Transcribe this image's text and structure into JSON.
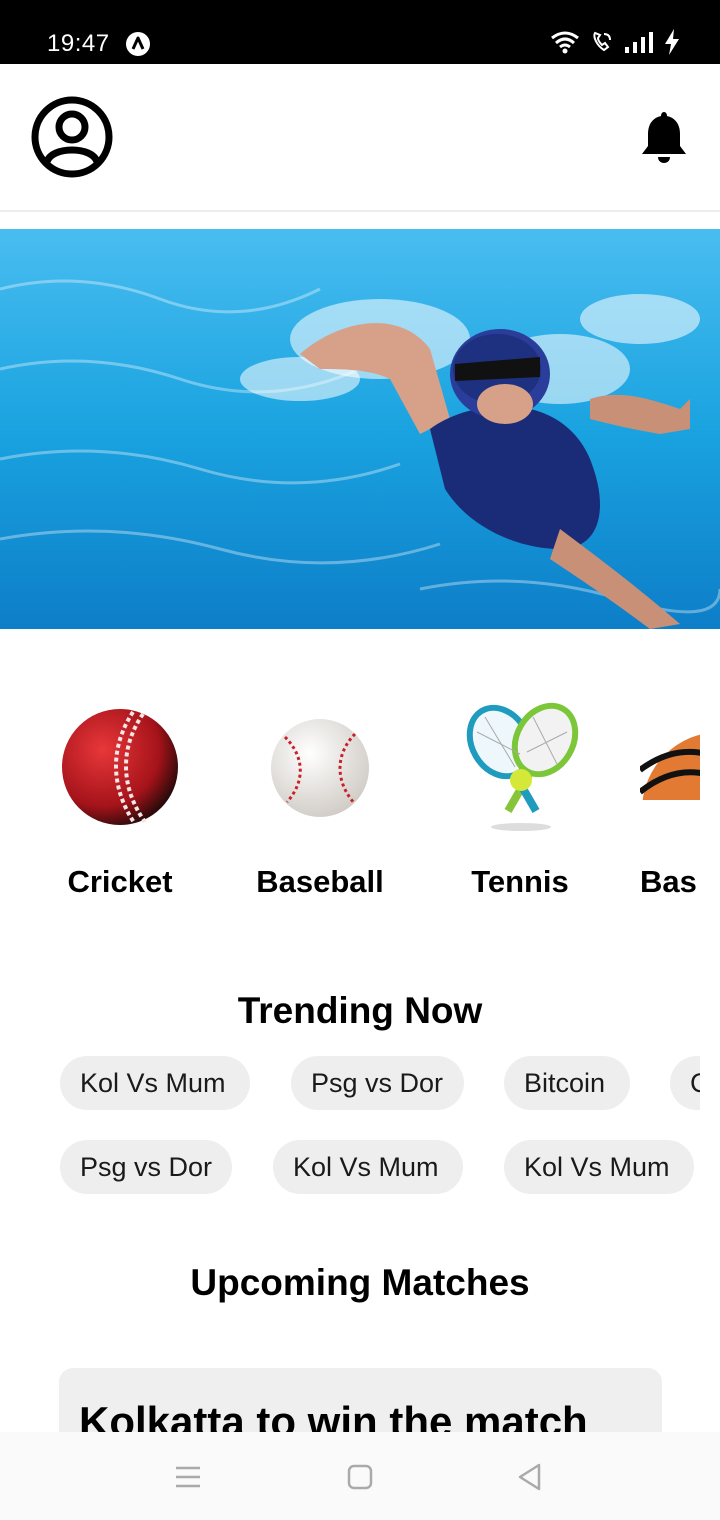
{
  "status_bar": {
    "time": "19:47",
    "app_icon": "a-circle-icon",
    "icons": [
      "wifi-icon",
      "wifi-call-icon",
      "signal-icon",
      "charging-icon"
    ]
  },
  "header": {
    "avatar_icon": "user-avatar-icon",
    "notification_icon": "bell-icon"
  },
  "hero": {
    "image": "swimmer-in-pool"
  },
  "categories": [
    {
      "label": "Cricket",
      "icon": "cricket-ball-icon"
    },
    {
      "label": "Baseball",
      "icon": "baseball-icon"
    },
    {
      "label": "Tennis",
      "icon": "tennis-rackets-icon"
    },
    {
      "label": "Bas",
      "icon": "basketball-icon"
    }
  ],
  "trending": {
    "title": "Trending Now",
    "row1": [
      "Kol Vs Mum",
      "Psg vs Dor",
      "Bitcoin",
      "C"
    ],
    "row2": [
      "Psg vs Dor",
      "Kol Vs Mum",
      "Kol Vs Mum"
    ]
  },
  "upcoming": {
    "title": "Upcoming Matches",
    "matches": [
      {
        "title": "Kolkatta to win the match"
      }
    ]
  },
  "nav_bar": {
    "buttons": [
      "menu-icon",
      "home-square-icon",
      "back-triangle-icon"
    ]
  },
  "colors": {
    "chip_bg": "#eeeeee",
    "card_bg": "#efefef",
    "pool_blue": "#1aa3e0"
  }
}
